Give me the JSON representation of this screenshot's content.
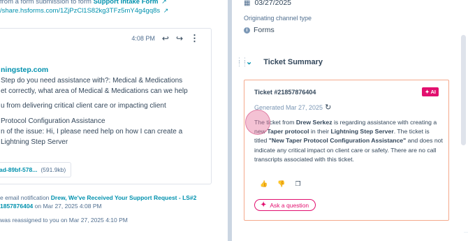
{
  "left": {
    "line1_prefix": "from a form submission to form",
    "line1_link": "Support Intake Form",
    "line2_url": "/share.hsforms.com/1ZjPzCl1S82kg3TFz5mY4g4gq8s",
    "email": {
      "time": "4:08 PM",
      "from": "ningstep.com",
      "lines": [
        "Step do you need assistance with?: Medical & Medications",
        "et correctly, what area of Medical & Medications can we help",
        "",
        "u from delivering critical client care or impacting client",
        "",
        " Protocol Configuration Assistance",
        "n of the issue: Hi, I please need help on how I can create a",
        " Lightning Step Server"
      ],
      "attachment_name": "ad-89bf-578...",
      "attachment_size": "(591.9kb)"
    },
    "activity1_prefix": "e email notification",
    "activity1_link": "Drew, We've Received Your Support Request - LS#2",
    "activity1_link2": "1857876404",
    "activity1_suffix": " on Mar 27, 2025 4:08 PM",
    "activity2": " was reassigned to you on Mar 27, 2025 4:10 PM"
  },
  "right": {
    "date": "03/27/2025",
    "channel_label": "Originating channel type",
    "channel_value": "Forms",
    "section_title": "Ticket Summary",
    "card": {
      "ticket_id": "Ticket #21857876404",
      "ai_badge": "AI",
      "generated": "Generated Mar 27, 2025",
      "summary": [
        {
          "t": "The ticket from ",
          "b": false
        },
        {
          "t": "Drew Serkez",
          "b": true
        },
        {
          "t": " is regarding assistance with creating a new ",
          "b": false
        },
        {
          "t": "Taper protocol",
          "b": true
        },
        {
          "t": " in their ",
          "b": false
        },
        {
          "t": "Lightning Step Server",
          "b": true
        },
        {
          "t": ". The ticket is titled ",
          "b": false
        },
        {
          "t": "\"New Taper Protocol Configuration Assistance\"",
          "b": true
        },
        {
          "t": " and does not indicate any critical impact on client care or safety. There are no call transcripts associated with this ticket.",
          "b": false
        }
      ],
      "ask_label": "Ask a question"
    }
  },
  "colors": {
    "link": "#0091ae",
    "accent_pink": "#e2106f",
    "card_border": "#f5a98c",
    "divider": "#cbd6e2"
  }
}
